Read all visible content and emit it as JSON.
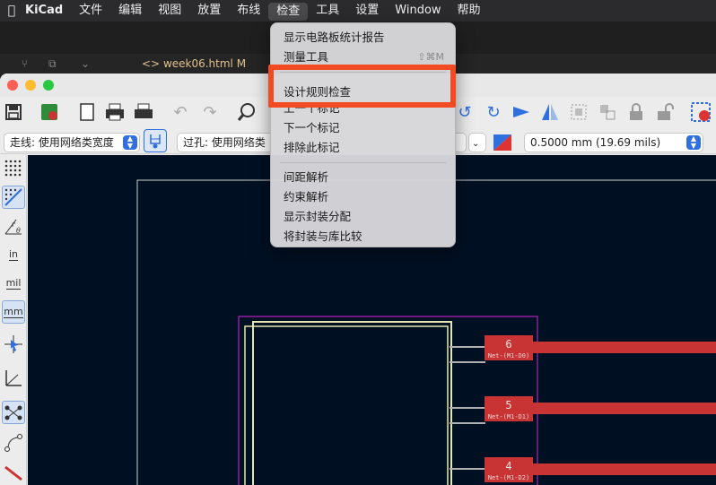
{
  "menubar": {
    "apple_icon": "apple-icon",
    "items": [
      "KiCad",
      "文件",
      "编辑",
      "视图",
      "放置",
      "布线",
      "检查",
      "工具",
      "设置",
      "Window",
      "帮助"
    ],
    "active_index": 6
  },
  "vscode": {
    "tab_label": "week06.html M"
  },
  "dropdown": {
    "items": [
      {
        "label": "显示电路板统计报告",
        "shortcut": ""
      },
      {
        "label": "测量工具",
        "shortcut": "⇧⌘M"
      },
      {
        "label": "设计规则检查",
        "shortcut": ""
      },
      {
        "label": "上一个标记",
        "shortcut": ""
      },
      {
        "label": "下一个标记",
        "shortcut": ""
      },
      {
        "label": "排除此标记",
        "shortcut": ""
      },
      {
        "label": "间距解析",
        "shortcut": ""
      },
      {
        "label": "约束解析",
        "shortcut": ""
      },
      {
        "label": "显示封装分配",
        "shortcut": ""
      },
      {
        "label": "将封装与库比较",
        "shortcut": ""
      }
    ]
  },
  "optbar": {
    "track_select": "走线: 使用网络类宽度",
    "via_select": "过孔: 使用网络类",
    "grid_select": "0.5000 mm (19.69 mils)"
  },
  "lefttools": {
    "in_label": "in",
    "mil_label": "mil",
    "mm_label": "mm"
  },
  "pcb": {
    "pads": [
      {
        "number": "6",
        "net": "Net-(M1-D0)"
      },
      {
        "number": "5",
        "net": "Net-(M1-D1)"
      },
      {
        "number": "4",
        "net": "Net-(M1-D2)"
      }
    ],
    "colors": {
      "background": "#001023",
      "pad": "#c83434",
      "courtyard": "#e020e0",
      "silkscreen": "#e8e6b0",
      "edge": "#d0d0d0"
    }
  }
}
